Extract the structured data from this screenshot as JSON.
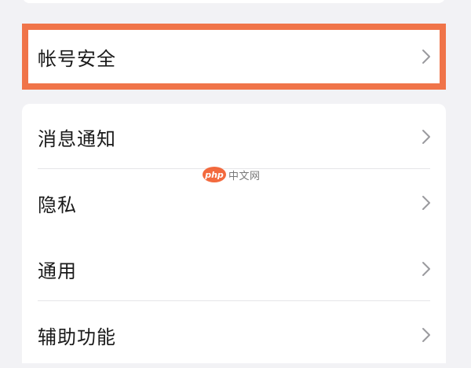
{
  "account_section": {
    "item": {
      "label": "帐号安全",
      "icon": "chevron-right-icon",
      "highlight_color": "#f07449"
    }
  },
  "settings_list": {
    "items": [
      {
        "label": "消息通知",
        "icon": "chevron-right-icon"
      },
      {
        "label": "隐私",
        "icon": "chevron-right-icon"
      },
      {
        "label": "通用",
        "icon": "chevron-right-icon"
      },
      {
        "label": "辅助功能",
        "icon": "chevron-right-icon"
      }
    ]
  },
  "watermark": {
    "logo": "php",
    "text": "中文网"
  }
}
